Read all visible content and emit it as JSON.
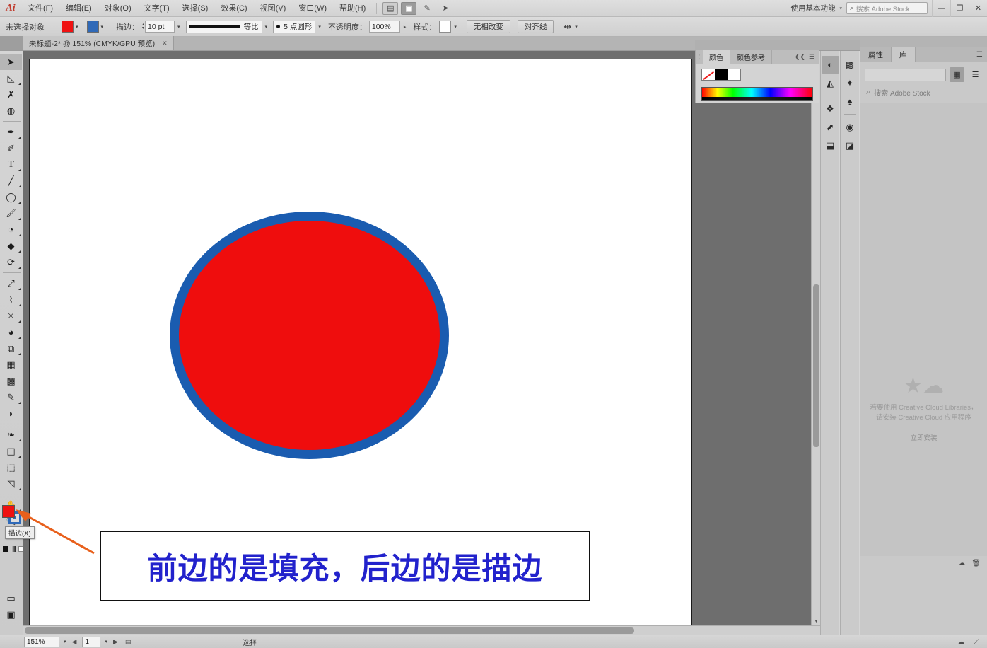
{
  "app": {
    "logo": "Ai",
    "title": "Adobe Illustrator"
  },
  "menubar": {
    "items": [
      {
        "label": "文件(F)"
      },
      {
        "label": "编辑(E)"
      },
      {
        "label": "对象(O)"
      },
      {
        "label": "文字(T)"
      },
      {
        "label": "选择(S)"
      },
      {
        "label": "效果(C)"
      },
      {
        "label": "视图(V)"
      },
      {
        "label": "窗口(W)"
      },
      {
        "label": "帮助(H)"
      }
    ],
    "icons": [
      {
        "name": "arrange-documents-icon",
        "glyph": "▤"
      },
      {
        "name": "screen-mode-icon",
        "glyph": "▣"
      },
      {
        "name": "brush-settings-icon",
        "glyph": "✎"
      },
      {
        "name": "share-icon",
        "glyph": "➤"
      }
    ],
    "workspace": "使用基本功能",
    "search_placeholder": "搜索 Adobe Stock",
    "search_icon": "search-icon",
    "window_controls": [
      "—",
      "❐",
      "✕"
    ]
  },
  "controlbar": {
    "selection_label": "未选择对象",
    "fill_color": "#ef1111",
    "fill_label": "填色",
    "stroke_color": "#2f69b8",
    "stroke_label": "描边颜色",
    "stroke_weight_label": "描边：",
    "stroke_weight_value": "10 pt",
    "stroke_profile": "等比",
    "brush_definition": "5 点圆形",
    "opacity_label": "不透明度：",
    "opacity_value": "100%",
    "style_label": "样式：",
    "transform_button": "无相改变",
    "align_button": "对齐线",
    "document_setup_icon": "doc-setup-icon"
  },
  "doctab": {
    "title": "未标题-2* @ 151% (CMYK/GPU 预览)",
    "close": "✕"
  },
  "toolbar": {
    "tools": [
      {
        "name": "selection-tool",
        "glyph": "➤",
        "selected": true,
        "flyout": false
      },
      {
        "name": "direct-selection-tool",
        "glyph": "◺",
        "selected": false,
        "flyout": true
      },
      {
        "name": "magic-wand-tool",
        "glyph": "✗",
        "selected": false,
        "flyout": false
      },
      {
        "name": "lasso-tool",
        "glyph": "◍",
        "selected": false,
        "flyout": false
      },
      {
        "name": "pen-tool",
        "glyph": "✒",
        "selected": false,
        "flyout": true
      },
      {
        "name": "curvature-tool",
        "glyph": "✐",
        "selected": false,
        "flyout": false
      },
      {
        "name": "type-tool",
        "glyph": "T",
        "selected": false,
        "flyout": true
      },
      {
        "name": "line-segment-tool",
        "glyph": "╱",
        "selected": false,
        "flyout": true
      },
      {
        "name": "ellipse-tool",
        "glyph": "◯",
        "selected": false,
        "flyout": true
      },
      {
        "name": "paintbrush-tool",
        "glyph": "🖌",
        "selected": false,
        "flyout": true
      },
      {
        "name": "shaper-tool",
        "glyph": "◔",
        "selected": false,
        "flyout": true
      },
      {
        "name": "eraser-tool",
        "glyph": "◆",
        "selected": false,
        "flyout": true
      },
      {
        "name": "rotate-tool",
        "glyph": "⟳",
        "selected": false,
        "flyout": true
      },
      {
        "name": "scale-tool",
        "glyph": "⤢",
        "selected": false,
        "flyout": true
      },
      {
        "name": "width-tool",
        "glyph": "⌇",
        "selected": false,
        "flyout": true
      },
      {
        "name": "free-transform-tool",
        "glyph": "✳",
        "selected": false,
        "flyout": true
      },
      {
        "name": "shape-builder-tool",
        "glyph": "◕",
        "selected": false,
        "flyout": true
      },
      {
        "name": "perspective-grid-tool",
        "glyph": "⧉",
        "selected": false,
        "flyout": true
      },
      {
        "name": "mesh-tool",
        "glyph": "▦",
        "selected": false,
        "flyout": false
      },
      {
        "name": "gradient-tool",
        "glyph": "▩",
        "selected": false,
        "flyout": false
      },
      {
        "name": "eyedropper-tool",
        "glyph": "✎",
        "selected": false,
        "flyout": true
      },
      {
        "name": "blend-tool",
        "glyph": "◗",
        "selected": false,
        "flyout": false
      },
      {
        "name": "symbol-sprayer-tool",
        "glyph": "❧",
        "selected": false,
        "flyout": true
      },
      {
        "name": "column-graph-tool",
        "glyph": "◫",
        "selected": false,
        "flyout": true
      },
      {
        "name": "artboard-tool",
        "glyph": "⬚",
        "selected": false,
        "flyout": false
      },
      {
        "name": "slice-tool",
        "glyph": "◹",
        "selected": false,
        "flyout": true
      },
      {
        "name": "hand-tool",
        "glyph": "✋",
        "selected": false,
        "flyout": true
      },
      {
        "name": "zoom-tool",
        "glyph": "🔍",
        "selected": false,
        "flyout": false
      }
    ],
    "fill_stroke": {
      "fill_color": "#ef1111",
      "stroke_color": "#2f69b8",
      "swap_icon": "swap-fill-stroke-icon",
      "default_icon": "default-fill-stroke-icon"
    },
    "tooltip": "描边(X)",
    "bottom_tools": [
      {
        "name": "color-mode-icon",
        "glyph": "◉"
      },
      {
        "name": "gradient-mode-icon",
        "glyph": "▧"
      },
      {
        "name": "none-mode-icon",
        "glyph": "∅"
      },
      {
        "name": "drawing-mode-icon",
        "glyph": "▭"
      },
      {
        "name": "screen-mode-icon",
        "glyph": "▣"
      }
    ]
  },
  "canvas": {
    "artboard_background": "#ffffff",
    "shape": {
      "name": "ellipse",
      "fill": "#ef0d0d",
      "stroke": "#1a5cb0",
      "stroke_width": "13px"
    },
    "annotation": {
      "text": "前边的是填充，后边的是描边",
      "color": "#2222cc",
      "border_color": "#111111",
      "arrow_color": "#e8601c"
    }
  },
  "colorpanel": {
    "tabs": [
      {
        "label": "颜色",
        "active": true
      },
      {
        "label": "颜色参考",
        "active": false
      }
    ],
    "collapse_icon": "collapse-icon",
    "menu_icon": "panel-menu-icon",
    "swatches": [
      "none",
      "black",
      "white"
    ],
    "spectrum_name": "color-spectrum-ramp"
  },
  "rails": {
    "rail1": [
      {
        "name": "color-panel-icon",
        "glyph": "◐",
        "selected": true
      },
      {
        "name": "color-guide-icon",
        "glyph": "◭",
        "selected": false
      },
      {
        "name": "layers-panel-icon",
        "glyph": "❖",
        "selected": false
      },
      {
        "name": "links-panel-icon",
        "glyph": "⬈",
        "selected": false
      },
      {
        "name": "pathfinder-panel-icon",
        "glyph": "⬓",
        "selected": false
      }
    ],
    "rail2": [
      {
        "name": "swatches-panel-icon",
        "glyph": "▩",
        "selected": false
      },
      {
        "name": "brushes-panel-icon",
        "glyph": "✦",
        "selected": false
      },
      {
        "name": "symbols-panel-icon",
        "glyph": "♠",
        "selected": false
      },
      {
        "name": "appearance-panel-icon",
        "glyph": "◉",
        "selected": false
      },
      {
        "name": "graphic-styles-icon",
        "glyph": "◪",
        "selected": false
      }
    ]
  },
  "libraries": {
    "tabs": [
      {
        "label": "属性",
        "active": false
      },
      {
        "label": "库",
        "active": true
      }
    ],
    "panel_menu_icon": "panel-menu-icon",
    "input_value": "",
    "view_buttons": [
      {
        "name": "grid-view-icon",
        "glyph": "▦",
        "selected": true
      },
      {
        "name": "list-view-icon",
        "glyph": "☰",
        "selected": false
      }
    ],
    "search_icon": "search-icon",
    "search_placeholder": "搜索 Adobe Stock",
    "empty_state": {
      "icon": "cloud-libraries-icon",
      "line1": "若要使用 Creative Cloud Libraries，",
      "line2": "请安装 Creative Cloud 应用程序",
      "link": "立即安装"
    },
    "footer_icons": [
      {
        "name": "new-library-icon",
        "glyph": "☁"
      },
      {
        "name": "delete-icon",
        "glyph": "🗑"
      }
    ]
  },
  "statusbar": {
    "zoom_value": "151%",
    "page_value": "1",
    "nav_first": "◀",
    "nav_last": "▶",
    "status_text": "选择",
    "right_icons": [
      {
        "name": "cloud-sync-icon",
        "glyph": "☁"
      },
      {
        "name": "resize-grip-icon",
        "glyph": "⟋"
      }
    ]
  }
}
